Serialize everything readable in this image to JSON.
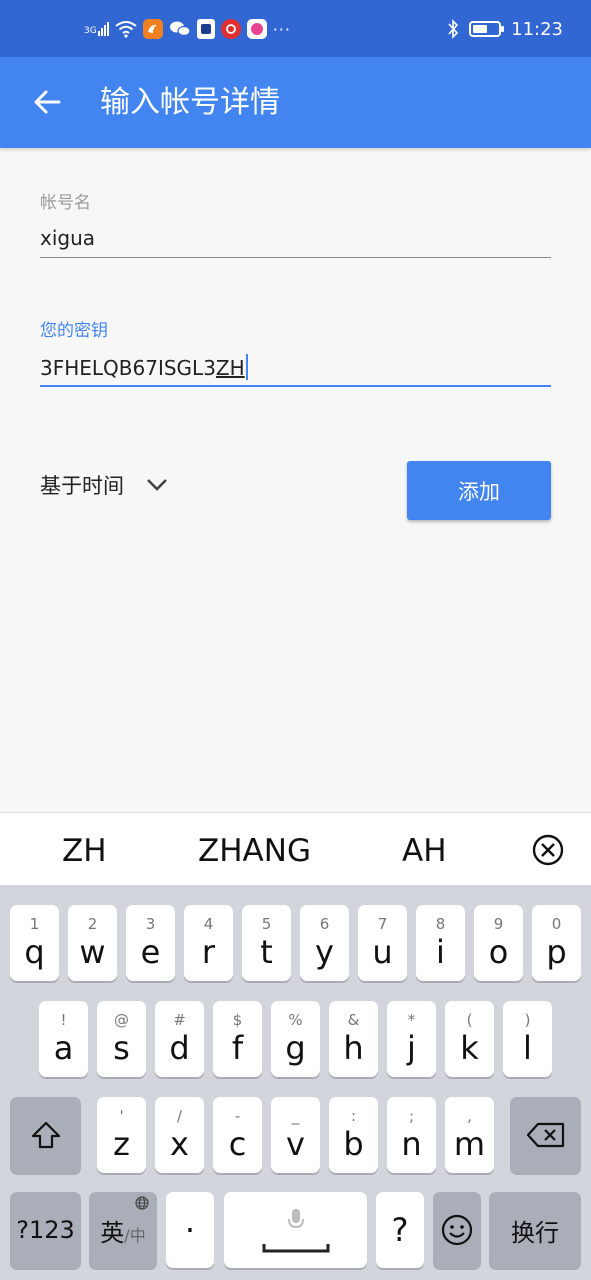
{
  "status_bar": {
    "network": "3G",
    "icons": [
      "signal-icon",
      "wifi-icon",
      "uc-browser-icon",
      "wechat-icon",
      "sim-icon",
      "netease-music-icon",
      "app-icon"
    ],
    "more": "···",
    "time": "11:23",
    "battery_level": 0.6
  },
  "app_bar": {
    "title": "输入帐号详情",
    "back_icon": "back-arrow-icon"
  },
  "form": {
    "account_label": "帐号名",
    "account_value": "xigua",
    "key_label": "您的密钥",
    "key_value_prefix": "3FHELQB67ISGL3",
    "key_value_composing": "ZH",
    "type_select": "基于时间",
    "add_button": "添加"
  },
  "colors": {
    "status_bar": "#3266d2",
    "app_bar": "#4285f0",
    "accent": "#4285f0",
    "label_gray": "#9a9a9a"
  },
  "suggestions": [
    "ZH",
    "ZHANG",
    "AH"
  ],
  "keyboard": {
    "row1": [
      {
        "hint": "1",
        "key": "q"
      },
      {
        "hint": "2",
        "key": "w"
      },
      {
        "hint": "3",
        "key": "e"
      },
      {
        "hint": "4",
        "key": "r"
      },
      {
        "hint": "5",
        "key": "t"
      },
      {
        "hint": "6",
        "key": "y"
      },
      {
        "hint": "7",
        "key": "u"
      },
      {
        "hint": "8",
        "key": "i"
      },
      {
        "hint": "9",
        "key": "o"
      },
      {
        "hint": "0",
        "key": "p"
      }
    ],
    "row2": [
      {
        "hint": "!",
        "key": "a"
      },
      {
        "hint": "@",
        "key": "s"
      },
      {
        "hint": "#",
        "key": "d"
      },
      {
        "hint": "$",
        "key": "f"
      },
      {
        "hint": "%",
        "key": "g"
      },
      {
        "hint": "&",
        "key": "h"
      },
      {
        "hint": "*",
        "key": "j"
      },
      {
        "hint": "(",
        "key": "k"
      },
      {
        "hint": ")",
        "key": "l"
      }
    ],
    "row3": [
      {
        "hint": "'",
        "key": "z"
      },
      {
        "hint": "/",
        "key": "x"
      },
      {
        "hint": "-",
        "key": "c"
      },
      {
        "hint": "_",
        "key": "v"
      },
      {
        "hint": ":",
        "key": "b"
      },
      {
        "hint": ";",
        "key": "n"
      },
      {
        "hint": ",",
        "key": "m"
      }
    ],
    "symbols_key": "?123",
    "lang_key": "英",
    "lang_key_sub": "/中",
    "dot_key": "·",
    "question_key": "?",
    "enter_key": "换行"
  }
}
